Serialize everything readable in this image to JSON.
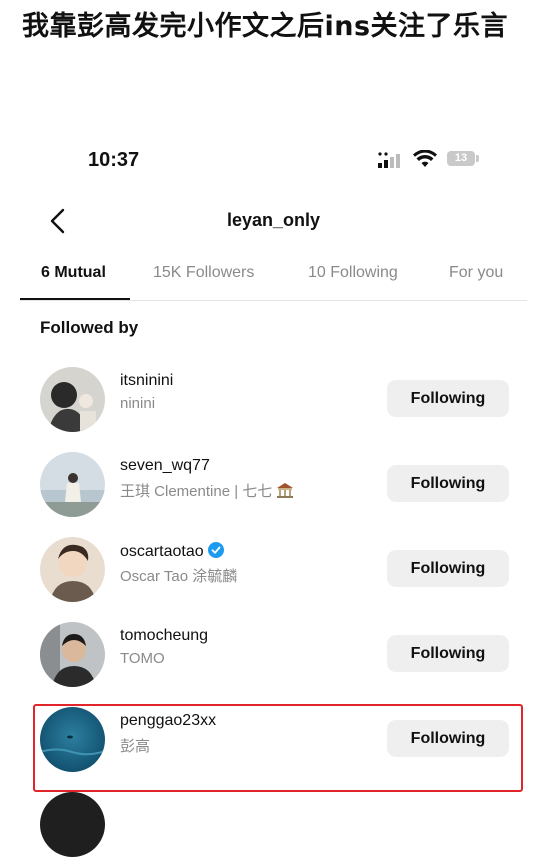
{
  "post_title": "我靠彭高发完小作文之后ins关注了乐言",
  "status_bar": {
    "time": "10:37",
    "battery": "13"
  },
  "header": {
    "back_icon": "chevron-left-icon",
    "title": "leyan_only"
  },
  "tabs": [
    {
      "label": "6 Mutual",
      "active": true
    },
    {
      "label": "15K Followers",
      "active": false
    },
    {
      "label": "10 Following",
      "active": false
    },
    {
      "label": "For you",
      "active": false
    }
  ],
  "section_title": "Followed by",
  "users": [
    {
      "username": "itsninini",
      "fullname": "ninini",
      "button": "Following",
      "verified": false
    },
    {
      "username": "seven_wq77",
      "fullname": "王琪 Clementine | 七七",
      "button": "Following",
      "verified": false
    },
    {
      "username": "oscartaotao",
      "fullname": "Oscar Tao 涂毓麟",
      "button": "Following",
      "verified": true
    },
    {
      "username": "tomocheung",
      "fullname": "TOMO",
      "button": "Following",
      "verified": false
    },
    {
      "username": "penggao23xx",
      "fullname": "彭高",
      "button": "Following",
      "verified": false,
      "highlighted": true
    }
  ],
  "colors": {
    "highlight_border": "#e0262b",
    "verified_badge": "#1d9bf0",
    "button_bg": "#efefef"
  }
}
